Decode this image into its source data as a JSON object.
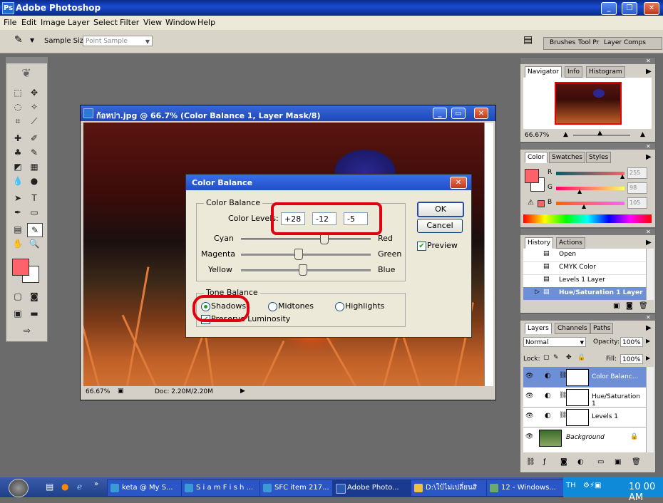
{
  "app": {
    "title": "Adobe Photoshop"
  },
  "menu": [
    "File",
    "Edit",
    "Image",
    "Layer",
    "Select",
    "Filter",
    "View",
    "Window",
    "Help"
  ],
  "options": {
    "sample_size_label": "Sample Size:",
    "sample_size_value": "Point Sample"
  },
  "palette_well": [
    "Brushes",
    "Tool Pr",
    "Layer Comps"
  ],
  "document": {
    "title": "ก้อหปา.jpg @ 66.7% (Color Balance 1, Layer Mask/8)",
    "zoom": "66.67%",
    "doc_size": "Doc: 2.20M/2.20M"
  },
  "dialog": {
    "title": "Color Balance",
    "group_label": "Color Balance",
    "levels_label": "Color Levels:",
    "levels": [
      "+28",
      "-12",
      "-5"
    ],
    "sliders": [
      {
        "left": "Cyan",
        "right": "Red",
        "value": 28
      },
      {
        "left": "Magenta",
        "right": "Green",
        "value": -12
      },
      {
        "left": "Yellow",
        "right": "Blue",
        "value": -5
      }
    ],
    "tone_label": "Tone Balance",
    "tone_options": [
      "Shadows",
      "Midtones",
      "Highlights"
    ],
    "tone_selected": "Shadows",
    "preserve_label": "Preserve Luminosity",
    "ok_label": "OK",
    "cancel_label": "Cancel",
    "preview_label": "Preview"
  },
  "navigator": {
    "tabs": [
      "Navigator",
      "Info",
      "Histogram"
    ],
    "zoom": "66.67%"
  },
  "color_panel": {
    "tabs": [
      "Color",
      "Swatches",
      "Styles"
    ],
    "channels": [
      {
        "label": "R",
        "value": "255"
      },
      {
        "label": "G",
        "value": "98"
      },
      {
        "label": "B",
        "value": "105"
      }
    ],
    "fg_color": "#ff6269"
  },
  "history": {
    "tabs": [
      "History",
      "Actions"
    ],
    "items": [
      "Open",
      "CMYK Color",
      "Levels 1 Layer",
      "Hue/Saturation 1 Layer"
    ],
    "selected": 3
  },
  "layers": {
    "tabs": [
      "Layers",
      "Channels",
      "Paths"
    ],
    "blend_mode": "Normal",
    "opacity_label": "Opacity:",
    "opacity": "100%",
    "lock_label": "Lock:",
    "fill_label": "Fill:",
    "fill": "100%",
    "items": [
      "Color Balanc...",
      "Hue/Saturation 1",
      "Levels 1",
      "Background"
    ],
    "selected": 0
  },
  "taskbar": {
    "items": [
      "keta @ My S...",
      "S i a m F i s h ...",
      "SFC item 217...",
      "Adobe Photo...",
      "D:\\ใบ้ไม่เปลี่ยนสิ",
      "12 - Windows..."
    ],
    "active": 3,
    "clock": "10 00 AM"
  }
}
